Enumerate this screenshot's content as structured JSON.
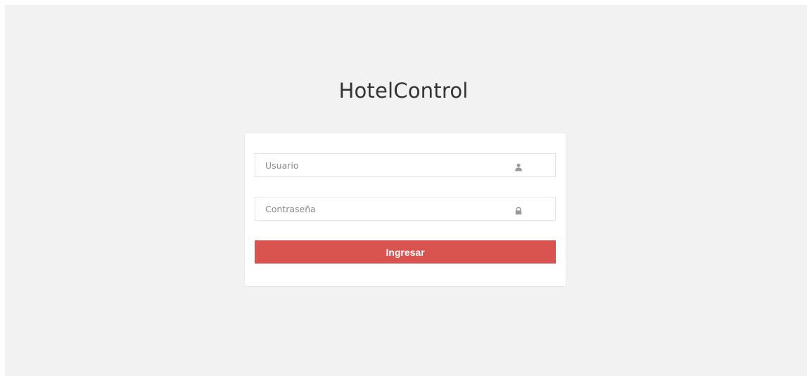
{
  "app": {
    "title": "HotelControl"
  },
  "login_form": {
    "username": {
      "placeholder": "Usuario",
      "value": "",
      "icon": "user-icon"
    },
    "password": {
      "placeholder": "Contraseña",
      "value": "",
      "icon": "lock-icon"
    },
    "submit_label": "Ingresar"
  },
  "colors": {
    "page_background": "#f2f2f2",
    "card_background": "#ffffff",
    "accent": "#d9534f",
    "title_text": "#333333",
    "icon": "#9a9a9a"
  }
}
